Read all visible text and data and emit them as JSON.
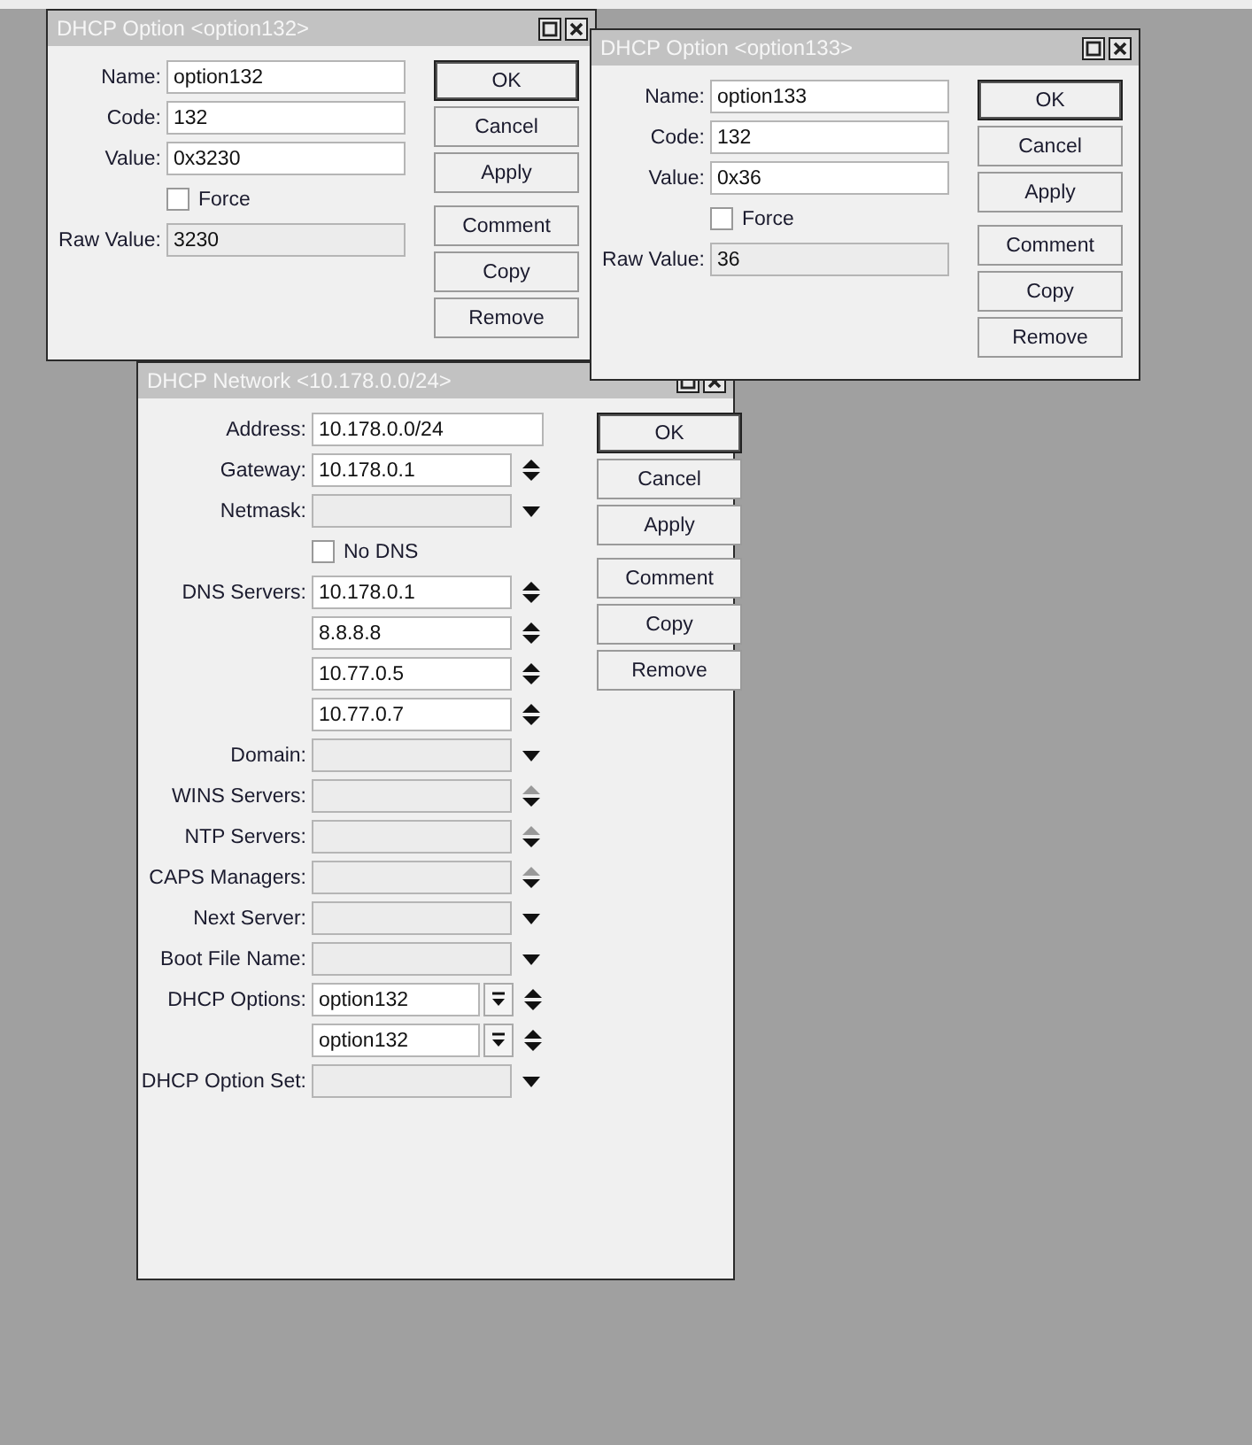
{
  "option_windows": [
    {
      "title": "DHCP Option <option132>",
      "rows": [
        {
          "kind": "text",
          "label": "Name:",
          "value": "option132"
        },
        {
          "kind": "text",
          "label": "Code:",
          "value": "132"
        },
        {
          "kind": "text",
          "label": "Value:",
          "value": "0x3230"
        },
        {
          "kind": "checkbox",
          "label": "Force",
          "checked": false
        },
        {
          "kind": "readonly",
          "label": "Raw Value:",
          "value": "3230"
        }
      ],
      "buttons": [
        {
          "label": "OK",
          "default": true
        },
        {
          "label": "Cancel",
          "default": false
        },
        {
          "label": "Apply",
          "default": false
        },
        {
          "label": "Comment",
          "default": false
        },
        {
          "label": "Copy",
          "default": false
        },
        {
          "label": "Remove",
          "default": false
        }
      ]
    },
    {
      "title": "DHCP Option <option133>",
      "rows": [
        {
          "kind": "text",
          "label": "Name:",
          "value": "option133"
        },
        {
          "kind": "text",
          "label": "Code:",
          "value": "132"
        },
        {
          "kind": "text",
          "label": "Value:",
          "value": "0x36"
        },
        {
          "kind": "checkbox",
          "label": "Force",
          "checked": false
        },
        {
          "kind": "readonly",
          "label": "Raw Value:",
          "value": "36"
        }
      ],
      "buttons": [
        {
          "label": "OK",
          "default": true
        },
        {
          "label": "Cancel",
          "default": false
        },
        {
          "label": "Apply",
          "default": false
        },
        {
          "label": "Comment",
          "default": false
        },
        {
          "label": "Copy",
          "default": false
        },
        {
          "label": "Remove",
          "default": false
        }
      ]
    }
  ],
  "network_window": {
    "title": "DHCP Network <10.178.0.0/24>",
    "rows": [
      {
        "kind": "text",
        "label": "Address:",
        "value": "10.178.0.0/24",
        "spin": false,
        "dropdown": false
      },
      {
        "kind": "text",
        "label": "Gateway:",
        "value": "10.178.0.1",
        "spin": true,
        "dropdown": false,
        "spin_dimmed": false
      },
      {
        "kind": "readonly",
        "label": "Netmask:",
        "spin": false,
        "dropdown": true
      },
      {
        "kind": "checkbox",
        "label": "No DNS",
        "checked": false
      },
      {
        "kind": "text",
        "label": "DNS Servers:",
        "value": "10.178.0.1",
        "spin": true,
        "dropdown": false,
        "spin_dimmed": false
      },
      {
        "kind": "text",
        "value": "8.8.8.8",
        "spin": true,
        "dropdown": false,
        "spin_dimmed": false
      },
      {
        "kind": "text",
        "value": "10.77.0.5",
        "spin": true,
        "dropdown": false,
        "spin_dimmed": false
      },
      {
        "kind": "text",
        "value": "10.77.0.7",
        "spin": true,
        "dropdown": false,
        "spin_dimmed": false
      },
      {
        "kind": "readonly",
        "label": "Domain:",
        "spin": false,
        "dropdown": true
      },
      {
        "kind": "readonly",
        "label": "WINS Servers:",
        "spin": true,
        "dropdown": false,
        "spin_dimmed": true
      },
      {
        "kind": "readonly",
        "label": "NTP Servers:",
        "spin": true,
        "dropdown": false,
        "spin_dimmed": true
      },
      {
        "kind": "readonly",
        "label": "CAPS Managers:",
        "spin": true,
        "dropdown": false,
        "spin_dimmed": true
      },
      {
        "kind": "readonly",
        "label": "Next Server:",
        "spin": false,
        "dropdown": true
      },
      {
        "kind": "readonly",
        "label": "Boot File Name:",
        "spin": false,
        "dropdown": true
      },
      {
        "kind": "select",
        "label": "DHCP Options:",
        "value": "option132",
        "spin": true,
        "dropdown": false,
        "spin_dimmed": false
      },
      {
        "kind": "select",
        "value": "option132",
        "spin": true,
        "dropdown": false,
        "spin_dimmed": false
      },
      {
        "kind": "readonly",
        "label": "DHCP Option Set:",
        "spin": false,
        "dropdown": true
      }
    ],
    "buttons": [
      {
        "label": "OK",
        "default": true
      },
      {
        "label": "Cancel",
        "default": false
      },
      {
        "label": "Apply",
        "default": false
      },
      {
        "label": "Comment",
        "default": false
      },
      {
        "label": "Copy",
        "default": false
      },
      {
        "label": "Remove",
        "default": false
      }
    ]
  }
}
